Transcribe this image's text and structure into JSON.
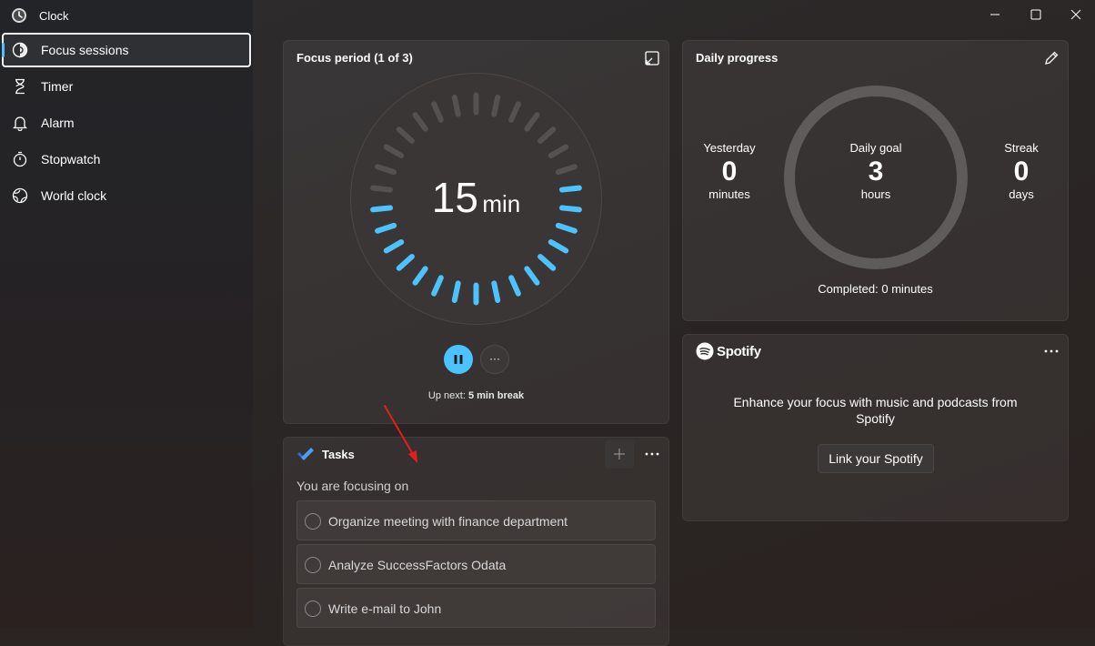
{
  "app": {
    "title": "Clock"
  },
  "nav": {
    "items": [
      {
        "label": "Focus sessions",
        "icon": "focus-icon",
        "active": true
      },
      {
        "label": "Timer",
        "icon": "hourglass-icon"
      },
      {
        "label": "Alarm",
        "icon": "bell-icon"
      },
      {
        "label": "Stopwatch",
        "icon": "stopwatch-icon"
      },
      {
        "label": "World clock",
        "icon": "globe-icon"
      }
    ]
  },
  "focus": {
    "title": "Focus period (1 of 3)",
    "time_value": "15",
    "time_unit": "min",
    "progress_fraction": 0.5,
    "up_next_label": "Up next:",
    "up_next_value": "5 min break",
    "more_label": "···"
  },
  "daily": {
    "title": "Daily progress",
    "yesterday": {
      "label": "Yesterday",
      "value": "0",
      "unit": "minutes"
    },
    "goal": {
      "label": "Daily goal",
      "value": "3",
      "unit": "hours"
    },
    "streak": {
      "label": "Streak",
      "value": "0",
      "unit": "days"
    },
    "completed": "Completed: 0 minutes"
  },
  "spotify": {
    "brand": "Spotify",
    "message": "Enhance your focus with music and podcasts from Spotify",
    "link_button": "Link your Spotify"
  },
  "tasks": {
    "title": "Tasks",
    "subtitle": "You are focusing on",
    "items": [
      "Organize meeting with finance department",
      "Analyze SuccessFactors Odata",
      "Write e-mail to John"
    ]
  },
  "colors": {
    "accent": "#4cc2ff",
    "arrow": "#e0201b"
  }
}
